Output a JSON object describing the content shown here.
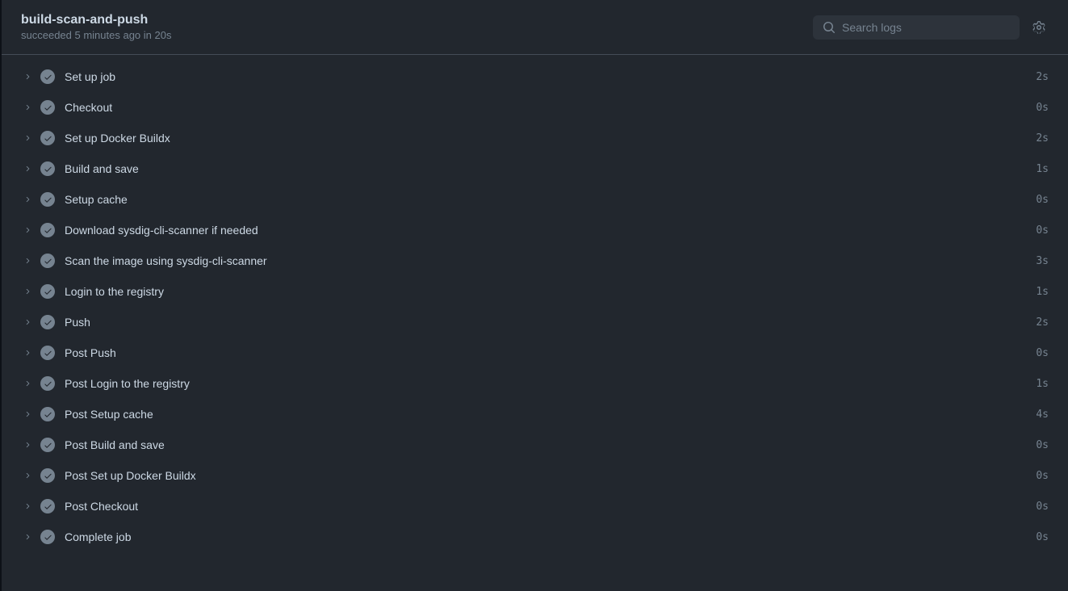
{
  "header": {
    "title": "build-scan-and-push",
    "status": "succeeded 5 minutes ago in 20s",
    "search_placeholder": "Search logs"
  },
  "steps": [
    {
      "name": "Set up job",
      "duration": "2s"
    },
    {
      "name": "Checkout",
      "duration": "0s"
    },
    {
      "name": "Set up Docker Buildx",
      "duration": "2s"
    },
    {
      "name": "Build and save",
      "duration": "1s"
    },
    {
      "name": "Setup cache",
      "duration": "0s"
    },
    {
      "name": "Download sysdig-cli-scanner if needed",
      "duration": "0s"
    },
    {
      "name": "Scan the image using sysdig-cli-scanner",
      "duration": "3s"
    },
    {
      "name": "Login to the registry",
      "duration": "1s"
    },
    {
      "name": "Push",
      "duration": "2s"
    },
    {
      "name": "Post Push",
      "duration": "0s"
    },
    {
      "name": "Post Login to the registry",
      "duration": "1s"
    },
    {
      "name": "Post Setup cache",
      "duration": "4s"
    },
    {
      "name": "Post Build and save",
      "duration": "0s"
    },
    {
      "name": "Post Set up Docker Buildx",
      "duration": "0s"
    },
    {
      "name": "Post Checkout",
      "duration": "0s"
    },
    {
      "name": "Complete job",
      "duration": "0s"
    }
  ]
}
